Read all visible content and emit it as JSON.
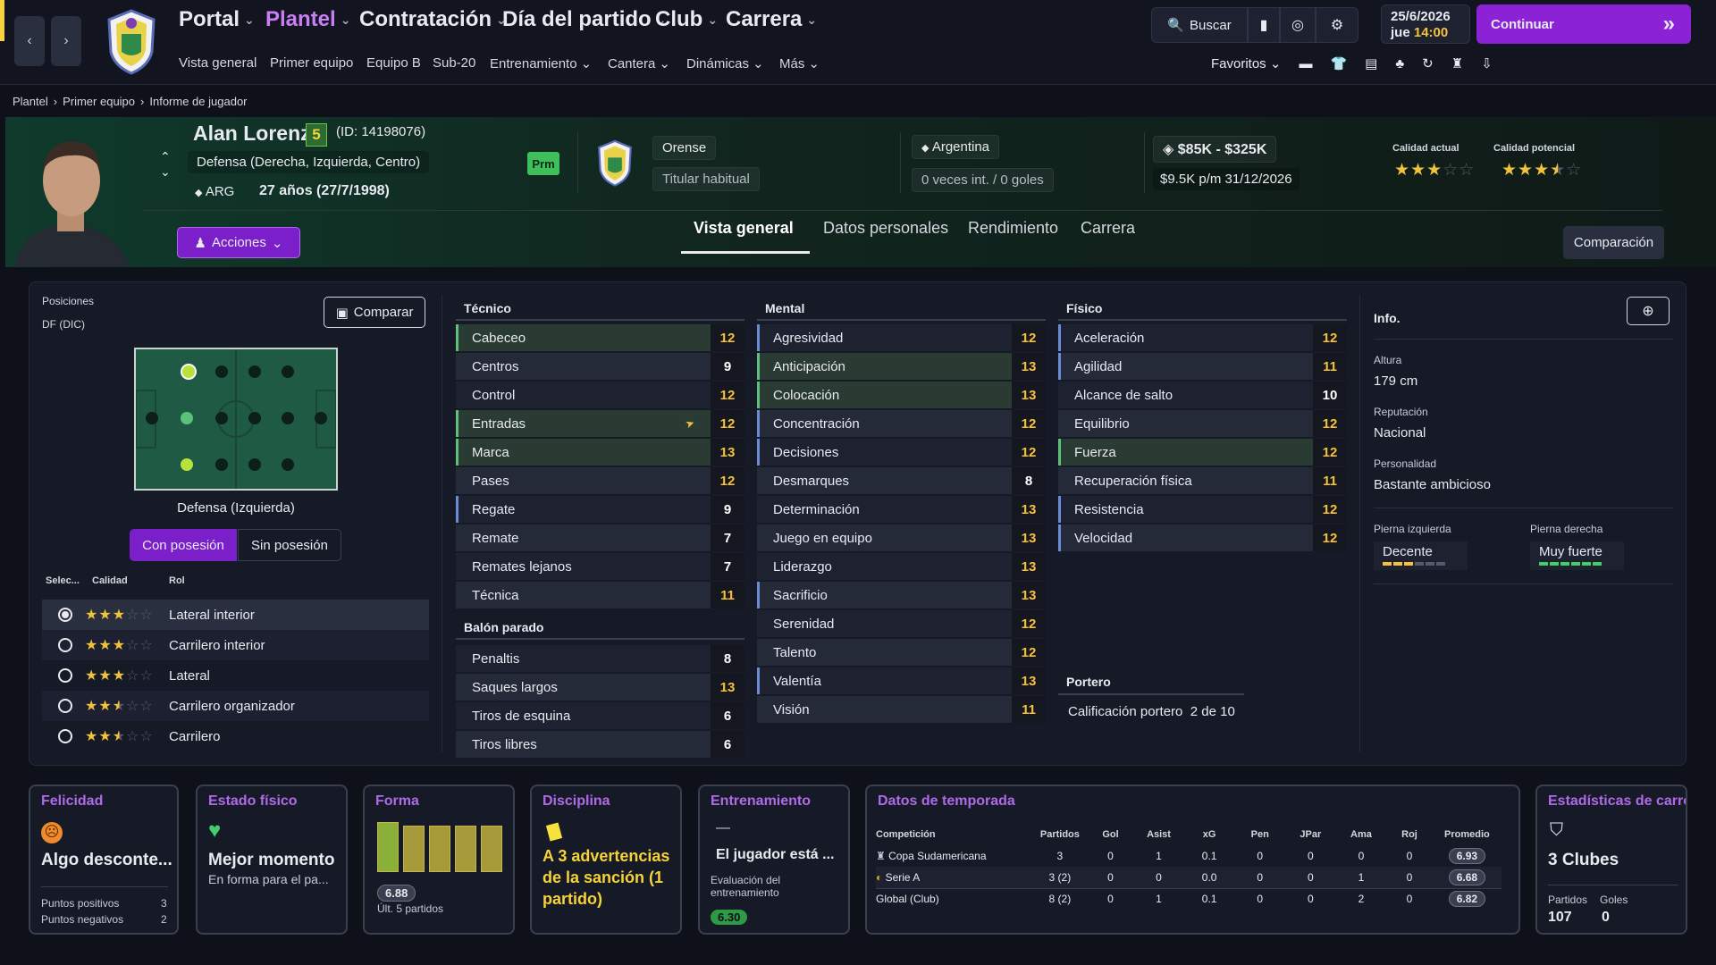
{
  "nav": {
    "main": [
      "Portal",
      "Plantel",
      "Contratación",
      "Día del partido",
      "Club",
      "Carrera"
    ],
    "sub": [
      "Vista general",
      "Primer equipo",
      "Equipo B",
      "Sub-20",
      "Entrenamiento",
      "Cantera",
      "Dinámicas",
      "Más"
    ],
    "search": "Buscar",
    "favorites": "Favoritos",
    "date": "25/6/2026",
    "weekday": "jue",
    "time": "14:00",
    "continue": "Continuar"
  },
  "breadcrumb": [
    "Plantel",
    "Primer equipo",
    "Informe de jugador"
  ],
  "player": {
    "name": "Alan Lorenzo",
    "number": "5",
    "id": "(ID: 14198076)",
    "position": "Defensa (Derecha, Izquierda, Centro)",
    "nationality": "ARG",
    "age": "27 años (27/7/1998)",
    "badge": "Prm",
    "club": "Orense",
    "status": "Titular habitual",
    "country": "Argentina",
    "intl": "0 veces int. / 0 goles",
    "value": "$85K - $325K",
    "wage": "$9.5K p/m",
    "contract": "31/12/2026",
    "current_label": "Calidad actual",
    "potential_label": "Calidad potencial",
    "current_stars": 3,
    "potential_stars": 3.5,
    "actions": "Acciones",
    "compare": "Comparación"
  },
  "tabs": [
    "Vista general",
    "Datos personales",
    "Rendimiento",
    "Carrera"
  ],
  "positions": {
    "label": "Posiciones",
    "code": "DF (DIC)",
    "compare": "Comparar",
    "selected": "Defensa (Izquierda)",
    "with": "Con posesión",
    "without": "Sin posesión",
    "headers": [
      "Selec...",
      "Calidad",
      "Rol"
    ],
    "roles": [
      {
        "name": "Lateral interior",
        "stars": 3,
        "selected": true
      },
      {
        "name": "Carrilero interior",
        "stars": 3,
        "selected": false
      },
      {
        "name": "Lateral",
        "stars": 3,
        "selected": false
      },
      {
        "name": "Carrilero organizador",
        "stars": 2.5,
        "selected": false
      },
      {
        "name": "Carrilero",
        "stars": 2.5,
        "selected": false
      }
    ]
  },
  "attributes": {
    "tecnico_label": "Técnico",
    "tecnico": [
      {
        "n": "Cabeceo",
        "v": "12",
        "c": "y",
        "s": "hl"
      },
      {
        "n": "Centros",
        "v": "9",
        "c": "w",
        "s": ""
      },
      {
        "n": "Control",
        "v": "12",
        "c": "y",
        "s": ""
      },
      {
        "n": "Entradas",
        "v": "12",
        "c": "y",
        "s": "hl"
      },
      {
        "n": "Marca",
        "v": "13",
        "c": "y",
        "s": "hl"
      },
      {
        "n": "Pases",
        "v": "12",
        "c": "y",
        "s": ""
      },
      {
        "n": "Regate",
        "v": "9",
        "c": "w",
        "s": "bl"
      },
      {
        "n": "Remate",
        "v": "7",
        "c": "w",
        "s": ""
      },
      {
        "n": "Remates lejanos",
        "v": "7",
        "c": "w",
        "s": ""
      },
      {
        "n": "Técnica",
        "v": "11",
        "c": "y",
        "s": ""
      }
    ],
    "balon_label": "Balón parado",
    "balon": [
      {
        "n": "Penaltis",
        "v": "8",
        "c": "w",
        "s": ""
      },
      {
        "n": "Saques largos",
        "v": "13",
        "c": "y",
        "s": ""
      },
      {
        "n": "Tiros de esquina",
        "v": "6",
        "c": "w",
        "s": ""
      },
      {
        "n": "Tiros libres",
        "v": "6",
        "c": "w",
        "s": ""
      }
    ],
    "mental_label": "Mental",
    "mental": [
      {
        "n": "Agresividad",
        "v": "12",
        "c": "y",
        "s": "bl"
      },
      {
        "n": "Anticipación",
        "v": "13",
        "c": "y",
        "s": "hl"
      },
      {
        "n": "Colocación",
        "v": "13",
        "c": "y",
        "s": "hl"
      },
      {
        "n": "Concentración",
        "v": "12",
        "c": "y",
        "s": "bl"
      },
      {
        "n": "Decisiones",
        "v": "12",
        "c": "y",
        "s": "bl"
      },
      {
        "n": "Desmarques",
        "v": "8",
        "c": "w",
        "s": ""
      },
      {
        "n": "Determinación",
        "v": "13",
        "c": "y",
        "s": ""
      },
      {
        "n": "Juego en equipo",
        "v": "13",
        "c": "y",
        "s": ""
      },
      {
        "n": "Liderazgo",
        "v": "13",
        "c": "y",
        "s": ""
      },
      {
        "n": "Sacrificio",
        "v": "13",
        "c": "y",
        "s": "bl"
      },
      {
        "n": "Serenidad",
        "v": "12",
        "c": "y",
        "s": ""
      },
      {
        "n": "Talento",
        "v": "12",
        "c": "y",
        "s": ""
      },
      {
        "n": "Valentía",
        "v": "13",
        "c": "y",
        "s": "bl"
      },
      {
        "n": "Visión",
        "v": "11",
        "c": "y",
        "s": ""
      }
    ],
    "fisico_label": "Físico",
    "fisico": [
      {
        "n": "Aceleración",
        "v": "12",
        "c": "y",
        "s": "bl"
      },
      {
        "n": "Agilidad",
        "v": "11",
        "c": "y",
        "s": "bl"
      },
      {
        "n": "Alcance de salto",
        "v": "10",
        "c": "w",
        "s": ""
      },
      {
        "n": "Equilibrio",
        "v": "12",
        "c": "y",
        "s": ""
      },
      {
        "n": "Fuerza",
        "v": "12",
        "c": "y",
        "s": "hl"
      },
      {
        "n": "Recuperación física",
        "v": "11",
        "c": "y",
        "s": ""
      },
      {
        "n": "Resistencia",
        "v": "12",
        "c": "y",
        "s": "bl"
      },
      {
        "n": "Velocidad",
        "v": "12",
        "c": "y",
        "s": "bl"
      }
    ],
    "portero_label": "Portero",
    "portero_text": "Calificación portero",
    "portero_value": "2 de 10"
  },
  "info": {
    "title": "Info.",
    "height_label": "Altura",
    "height": "179 cm",
    "rep_label": "Reputación",
    "rep": "Nacional",
    "pers_label": "Personalidad",
    "pers": "Bastante ambicioso",
    "left_label": "Pierna izquierda",
    "left": "Decente",
    "left_level": 3,
    "right_label": "Pierna derecha",
    "right": "Muy fuerte",
    "right_level": 6
  },
  "cards": {
    "felicidad": {
      "title": "Felicidad",
      "text": "Algo desconte...",
      "pos_label": "Puntos positivos",
      "pos": "3",
      "neg_label": "Puntos negativos",
      "neg": "2"
    },
    "estado": {
      "title": "Estado físico",
      "text": "Mejor momento",
      "sub": "En forma para el pa..."
    },
    "forma": {
      "title": "Forma",
      "rating": "6.88",
      "sub": "Últ. 5 partidos",
      "bars": [
        0.8,
        0.75,
        0.75,
        0.75,
        0.75
      ]
    },
    "disciplina": {
      "title": "Disciplina",
      "text": "A 3 advertencias de la sanción (1 partido)"
    },
    "entrenamiento": {
      "title": "Entrenamiento",
      "dash": "—",
      "text": "El jugador está ...",
      "sub": "Evaluación del entrenamiento",
      "rating": "6.30"
    },
    "temporada": {
      "title": "Datos de temporada",
      "headers": [
        "Competición",
        "Partidos",
        "Gol",
        "Asist",
        "xG",
        "Pen",
        "JPar",
        "Ama",
        "Roj",
        "Promedio"
      ],
      "rows": [
        [
          "Copa Sudamericana",
          "3",
          "0",
          "1",
          "0.1",
          "0",
          "0",
          "0",
          "0",
          "6.93"
        ],
        [
          "Serie A",
          "3 (2)",
          "0",
          "0",
          "0.0",
          "0",
          "0",
          "1",
          "0",
          "6.68"
        ],
        [
          "Global (Club)",
          "8 (2)",
          "0",
          "1",
          "0.1",
          "0",
          "0",
          "2",
          "0",
          "6.82"
        ]
      ]
    },
    "carrera": {
      "title": "Estadísticas de carrer",
      "clubs": "3 Clubes",
      "p_label": "Partidos",
      "p": "107",
      "g_label": "Goles",
      "g": "0"
    }
  },
  "colors": {
    "accent": "#8b22d6",
    "yellow": "#f6c238",
    "green": "#5ec17a",
    "purple": "#b06ae8"
  }
}
